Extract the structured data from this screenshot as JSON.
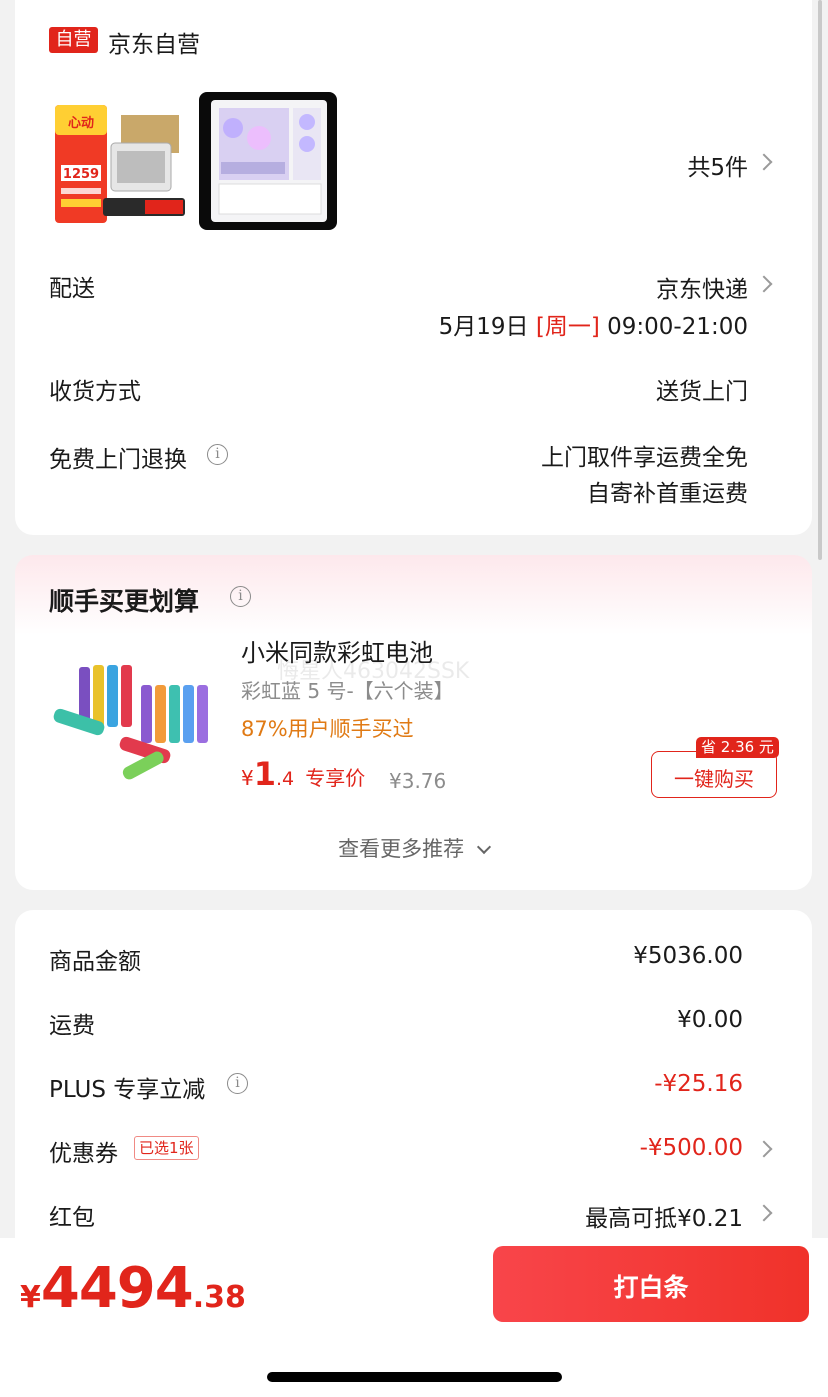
{
  "store": {
    "badge": "自营",
    "name": "京东自营"
  },
  "products": {
    "count_label": "共5件"
  },
  "delivery": {
    "label": "配送",
    "carrier": "京东快递",
    "date": "5月19日",
    "weekday": "[周一]",
    "time": "09:00-21:00"
  },
  "receive": {
    "label": "收货方式",
    "value": "送货上门"
  },
  "returns": {
    "label": "免费上门退换",
    "line1": "上门取件享运费全免",
    "line2": "自寄补首重运费"
  },
  "addon": {
    "title": "顺手买更划算",
    "product_name": "小米同款彩虹电池",
    "spec": "彩虹蓝 5 号-【六个装】",
    "users": "87%用户顺手买过",
    "currency": "¥",
    "price_int": "1",
    "price_dec": ".4",
    "price_tag": "专享价",
    "orig_price": "¥3.76",
    "save_badge": "省 2.36 元",
    "buy_label": "一键购买",
    "more_label": "查看更多推荐",
    "watermark": "悔星人463042SSK"
  },
  "summary": {
    "rows": [
      {
        "label": "商品金额",
        "value": "¥5036.00"
      },
      {
        "label": "运费",
        "value": "¥0.00"
      },
      {
        "label": "PLUS 专享立减",
        "value": "-¥25.16"
      },
      {
        "label": "优惠券",
        "tag": "已选1张",
        "value": "-¥500.00"
      },
      {
        "label": "红包",
        "value": "最高可抵¥0.21"
      }
    ]
  },
  "checkout": {
    "currency": "¥",
    "total_int": "4494",
    "total_dec": ".38",
    "pay_label": "打白条"
  },
  "colors": {
    "accent": "#e1251b",
    "orange": "#e07a14",
    "button": "#f0382c"
  }
}
